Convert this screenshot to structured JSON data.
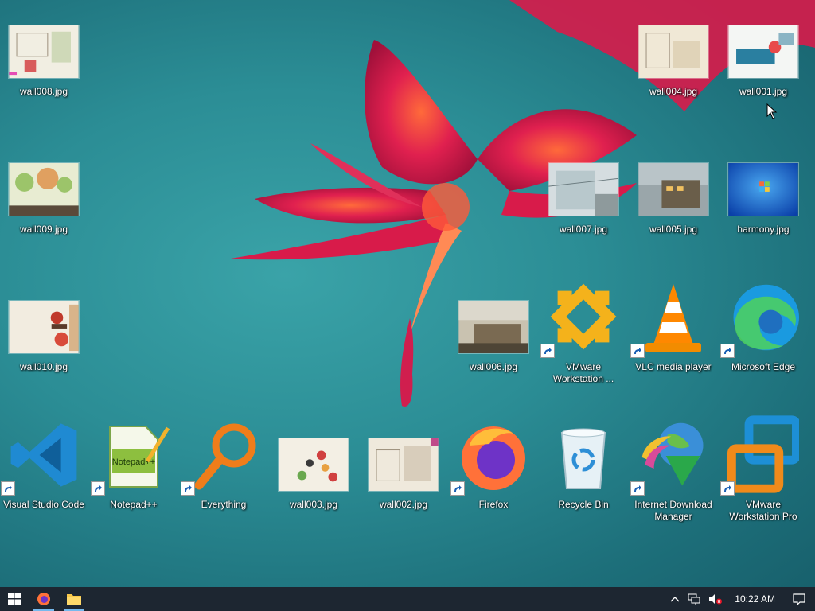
{
  "desktop_icons": [
    {
      "id": "wall008",
      "label": "wall008.jpg",
      "icon": "image-thumbnail"
    },
    {
      "id": "wall009",
      "label": "wall009.jpg",
      "icon": "image-thumbnail"
    },
    {
      "id": "wall010",
      "label": "wall010.jpg",
      "icon": "image-thumbnail"
    },
    {
      "id": "vscode",
      "label": "Visual Studio Code",
      "icon": "vscode-icon"
    },
    {
      "id": "notepadpp",
      "label": "Notepad++",
      "icon": "notepadpp-icon"
    },
    {
      "id": "everything",
      "label": "Everything",
      "icon": "magnifier-icon"
    },
    {
      "id": "wall003",
      "label": "wall003.jpg",
      "icon": "image-thumbnail"
    },
    {
      "id": "wall002",
      "label": "wall002.jpg",
      "icon": "image-thumbnail"
    },
    {
      "id": "wall006",
      "label": "wall006.jpg",
      "icon": "image-thumbnail"
    },
    {
      "id": "firefox",
      "label": "Firefox",
      "icon": "firefox-icon"
    },
    {
      "id": "wall007",
      "label": "wall007.jpg",
      "icon": "image-thumbnail"
    },
    {
      "id": "vmware-ws",
      "label": "VMware Workstation ...",
      "icon": "vmware-icon"
    },
    {
      "id": "recycle",
      "label": "Recycle Bin",
      "icon": "recycle-bin-icon"
    },
    {
      "id": "wall004",
      "label": "wall004.jpg",
      "icon": "image-thumbnail"
    },
    {
      "id": "wall005",
      "label": "wall005.jpg",
      "icon": "image-thumbnail"
    },
    {
      "id": "vlc",
      "label": "VLC media player",
      "icon": "vlc-icon"
    },
    {
      "id": "idm",
      "label": "Internet Download Manager",
      "icon": "idm-icon"
    },
    {
      "id": "wall001",
      "label": "wall001.jpg",
      "icon": "image-thumbnail"
    },
    {
      "id": "harmony",
      "label": "harmony.jpg",
      "icon": "image-thumbnail"
    },
    {
      "id": "edge",
      "label": "Microsoft Edge",
      "icon": "edge-icon"
    },
    {
      "id": "vmware-pro",
      "label": "VMware Workstation Pro",
      "icon": "vmware-pro-icon"
    }
  ],
  "taskbar": {
    "start_icon": "windows-logo-icon",
    "pinned": [
      {
        "name": "Firefox",
        "icon": "firefox-icon",
        "active": true
      },
      {
        "name": "File Explorer",
        "icon": "folder-icon",
        "active": true
      }
    ],
    "tray": {
      "chevron": "chevron-up-icon",
      "network": "network-icon",
      "volume": "volume-muted-icon",
      "time": "10:22 AM",
      "notifications": "notification-icon"
    }
  }
}
